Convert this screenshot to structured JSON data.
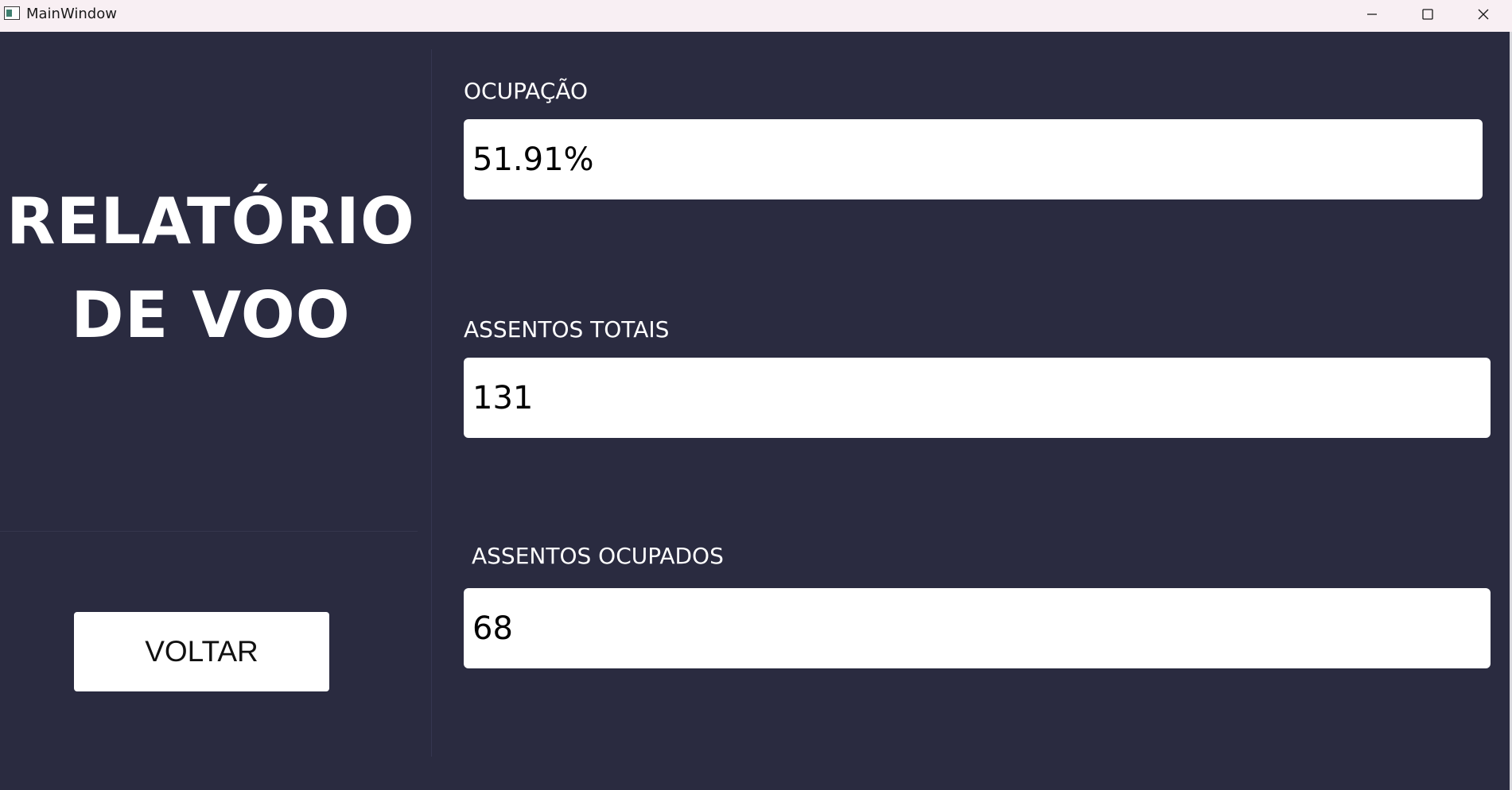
{
  "window": {
    "title": "MainWindow",
    "icons": {
      "app": "app-window-icon",
      "minimize": "minimize-icon",
      "maximize": "maximize-icon",
      "close": "close-icon"
    }
  },
  "left": {
    "title_line1": "RELATÓRIO",
    "title_line2": "DE VOO",
    "back_button": "VOLTAR"
  },
  "fields": {
    "ocupacao": {
      "label": "OCUPAÇÃO",
      "value": "51.91%"
    },
    "assentos_totais": {
      "label": "ASSENTOS TOTAIS",
      "value": "131"
    },
    "assentos_ocupados": {
      "label": "ASSENTOS OCUPADOS",
      "value": "68"
    }
  },
  "colors": {
    "background": "#2a2b40",
    "titlebar": "#f8eff3",
    "field": "#ffffff",
    "text_light": "#ffffff"
  }
}
